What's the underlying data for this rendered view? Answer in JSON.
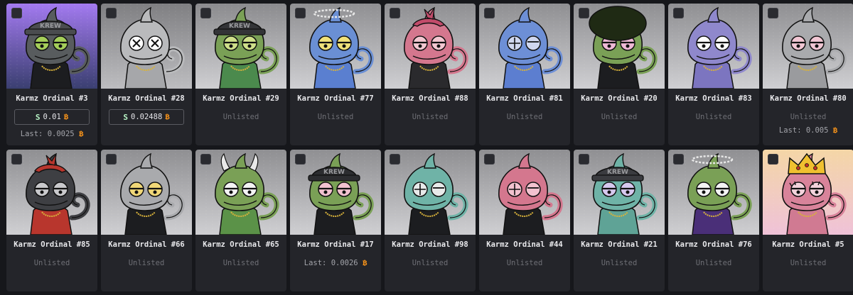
{
  "items": [
    {
      "title": "Karmz Ordinal #3",
      "unlisted": "",
      "price": "0.01",
      "last_label": "Last:",
      "last": "0.0025",
      "bg": [
        "#a37af0",
        "#3a3f70"
      ],
      "skin": "#585c5e",
      "hat": "krew",
      "hat_text": "KREW",
      "hat_color": "#4a4c4f",
      "eyes": "#a5cf5a",
      "eye_style": "normal",
      "outfit": "#1c1d20",
      "icon": "shield-person"
    },
    {
      "title": "Karmz Ordinal #28",
      "unlisted": "",
      "price": "0.02488",
      "last_label": "",
      "last": "",
      "bg": [
        "#7f7f82",
        "#bdbdc0"
      ],
      "skin": "#b9babc",
      "hat": "none",
      "hat_text": "",
      "hat_color": "",
      "eyes": "#ffffff",
      "eye_style": "x",
      "outfit": "#a6a7aa",
      "icon": "shield-person"
    },
    {
      "title": "Karmz Ordinal #29",
      "unlisted": "Unlisted",
      "price": "",
      "last_label": "",
      "last": "",
      "bg": [
        "#8b8b8e",
        "#cfcfd2"
      ],
      "skin": "#7aa056",
      "hat": "krew",
      "hat_text": "KREW",
      "hat_color": "#333437",
      "eyes": "#cfe08a",
      "eye_style": "normal",
      "outfit": "#4b8a4d",
      "icon": "shield-person"
    },
    {
      "title": "Karmz Ordinal #77",
      "unlisted": "Unlisted",
      "price": "",
      "last_label": "",
      "last": "",
      "bg": [
        "#8f8f92",
        "#cfcfd2"
      ],
      "skin": "#6a8fd4",
      "hat": "halo",
      "hat_text": "",
      "hat_color": "#e8e8e8",
      "eyes": "#f1e27a",
      "eye_style": "normal",
      "outfit": "#5a7fd0",
      "icon": "shield-person"
    },
    {
      "title": "Karmz Ordinal #88",
      "unlisted": "Unlisted",
      "price": "",
      "last_label": "",
      "last": "",
      "bg": [
        "#8f8f92",
        "#cfcfd2"
      ],
      "skin": "#d4778e",
      "hat": "bandana",
      "hat_text": "",
      "hat_color": "#c24b6a",
      "eyes": "#f4c8d2",
      "eye_style": "normal",
      "outfit": "#2a2a2d",
      "icon": "shield-person"
    },
    {
      "title": "Karmz Ordinal #81",
      "unlisted": "Unlisted",
      "price": "",
      "last_label": "",
      "last": "",
      "bg": [
        "#8f8f92",
        "#cfcfd2"
      ],
      "skin": "#6d8fd6",
      "hat": "none",
      "hat_text": "",
      "hat_color": "",
      "eyes": "#d0d7ef",
      "eye_style": "cross",
      "outfit": "#5c7ed0",
      "icon": "shield-person"
    },
    {
      "title": "Karmz Ordinal #20",
      "unlisted": "Unlisted",
      "price": "",
      "last_label": "",
      "last": "",
      "bg": [
        "#8f8f92",
        "#cfcfd2"
      ],
      "skin": "#7aa056",
      "hat": "afro",
      "hat_text": "",
      "hat_color": "#1f2a14",
      "eyes": "#f0b9d7",
      "eye_style": "normal",
      "outfit": "#1c1d20",
      "icon": "shield-person"
    },
    {
      "title": "Karmz Ordinal #83",
      "unlisted": "Unlisted",
      "price": "",
      "last_label": "",
      "last": "",
      "bg": [
        "#8f8f92",
        "#cfcfd2"
      ],
      "skin": "#8f88cc",
      "hat": "none",
      "hat_text": "",
      "hat_color": "",
      "eyes": "#ffffff",
      "eye_style": "normal",
      "outfit": "#7c75c0",
      "icon": "shield-person"
    },
    {
      "title": "Karmz Ordinal #80",
      "unlisted": "Unlisted",
      "price": "",
      "last_label": "Last:",
      "last": "0.005",
      "bg": [
        "#8f8f92",
        "#cfcfd2"
      ],
      "skin": "#a9aaad",
      "hat": "none",
      "hat_text": "",
      "hat_color": "",
      "eyes": "#f2c7d4",
      "eye_style": "normal",
      "outfit": "#9a9b9e",
      "icon": "shield-person"
    },
    {
      "title": "Karmz Ordinal #85",
      "unlisted": "Unlisted",
      "price": "",
      "last_label": "",
      "last": "",
      "bg": [
        "#8f8f92",
        "#cfcfd2"
      ],
      "skin": "#3e3f43",
      "hat": "bandana",
      "hat_text": "",
      "hat_color": "#b8362d",
      "eyes": "#c9c9cc",
      "eye_style": "normal",
      "outfit": "#b8362d",
      "icon": "shield-person"
    },
    {
      "title": "Karmz Ordinal #66",
      "unlisted": "Unlisted",
      "price": "",
      "last_label": "",
      "last": "",
      "bg": [
        "#8f8f92",
        "#cfcfd2"
      ],
      "skin": "#a9aaad",
      "hat": "none",
      "hat_text": "",
      "hat_color": "",
      "eyes": "#f1d878",
      "eye_style": "normal",
      "outfit": "#1c1d20",
      "icon": "shield-person"
    },
    {
      "title": "Karmz Ordinal #65",
      "unlisted": "Unlisted",
      "price": "",
      "last_label": "",
      "last": "",
      "bg": [
        "#8f8f92",
        "#cfcfd2"
      ],
      "skin": "#7aa056",
      "hat": "horns",
      "hat_text": "",
      "hat_color": "#e8e8e8",
      "eyes": "#f4f4f4",
      "eye_style": "normal",
      "outfit": "#5b9248",
      "icon": "shield-person"
    },
    {
      "title": "Karmz Ordinal #17",
      "unlisted": "",
      "price": "",
      "last_label": "Last:",
      "last": "0.0026",
      "bg": [
        "#8f8f92",
        "#cfcfd2"
      ],
      "skin": "#7aa056",
      "hat": "krew",
      "hat_text": "KREW",
      "hat_color": "#2c2d30",
      "eyes": "#f2c2cf",
      "eye_style": "normal",
      "outfit": "#1c1d20",
      "icon": "shield-person"
    },
    {
      "title": "Karmz Ordinal #98",
      "unlisted": "Unlisted",
      "price": "",
      "last_label": "",
      "last": "",
      "bg": [
        "#8f8f92",
        "#cfcfd2"
      ],
      "skin": "#6fb3a7",
      "hat": "none",
      "hat_text": "",
      "hat_color": "",
      "eyes": "#e8eaea",
      "eye_style": "cross",
      "outfit": "#1c1d20",
      "icon": "shield-person"
    },
    {
      "title": "Karmz Ordinal #44",
      "unlisted": "Unlisted",
      "price": "",
      "last_label": "",
      "last": "",
      "bg": [
        "#8f8f92",
        "#cfcfd2"
      ],
      "skin": "#d4778e",
      "hat": "none",
      "hat_text": "",
      "hat_color": "",
      "eyes": "#f2c2cf",
      "eye_style": "cross",
      "outfit": "#1c1d20",
      "icon": "shield-person"
    },
    {
      "title": "Karmz Ordinal #21",
      "unlisted": "Unlisted",
      "price": "",
      "last_label": "",
      "last": "",
      "bg": [
        "#8f8f92",
        "#cfcfd2"
      ],
      "skin": "#6fb3a7",
      "hat": "krew",
      "hat_text": "KREW",
      "hat_color": "#3a3b3f",
      "eyes": "#d6c8ee",
      "eye_style": "normal",
      "outfit": "#5fa396",
      "icon": "shield-person"
    },
    {
      "title": "Karmz Ordinal #76",
      "unlisted": "Unlisted",
      "price": "",
      "last_label": "",
      "last": "",
      "bg": [
        "#8f8f92",
        "#cfcfd2"
      ],
      "skin": "#7aa056",
      "hat": "halo",
      "hat_text": "",
      "hat_color": "#e8e8e8",
      "eyes": "#f4f4f4",
      "eye_style": "normal",
      "outfit": "#4a2f78",
      "icon": "shield-person"
    },
    {
      "title": "Karmz Ordinal #5",
      "unlisted": "Unlisted",
      "price": "",
      "last_label": "",
      "last": "",
      "bg": [
        "#f4d6a6",
        "#efc2d8"
      ],
      "skin": "#d8839a",
      "hat": "crown",
      "hat_text": "",
      "hat_color": "#f0c030",
      "eyes": "#f3d3dc",
      "eye_style": "lashes",
      "outfit": "#d07a92",
      "icon": "shield-person"
    }
  ],
  "colors": {
    "btc": "#f7931a",
    "card": "#24252a",
    "page": "#16171b"
  },
  "currency_icon": "bitcoin-icon",
  "marketplace_icon": "s-logo-icon"
}
